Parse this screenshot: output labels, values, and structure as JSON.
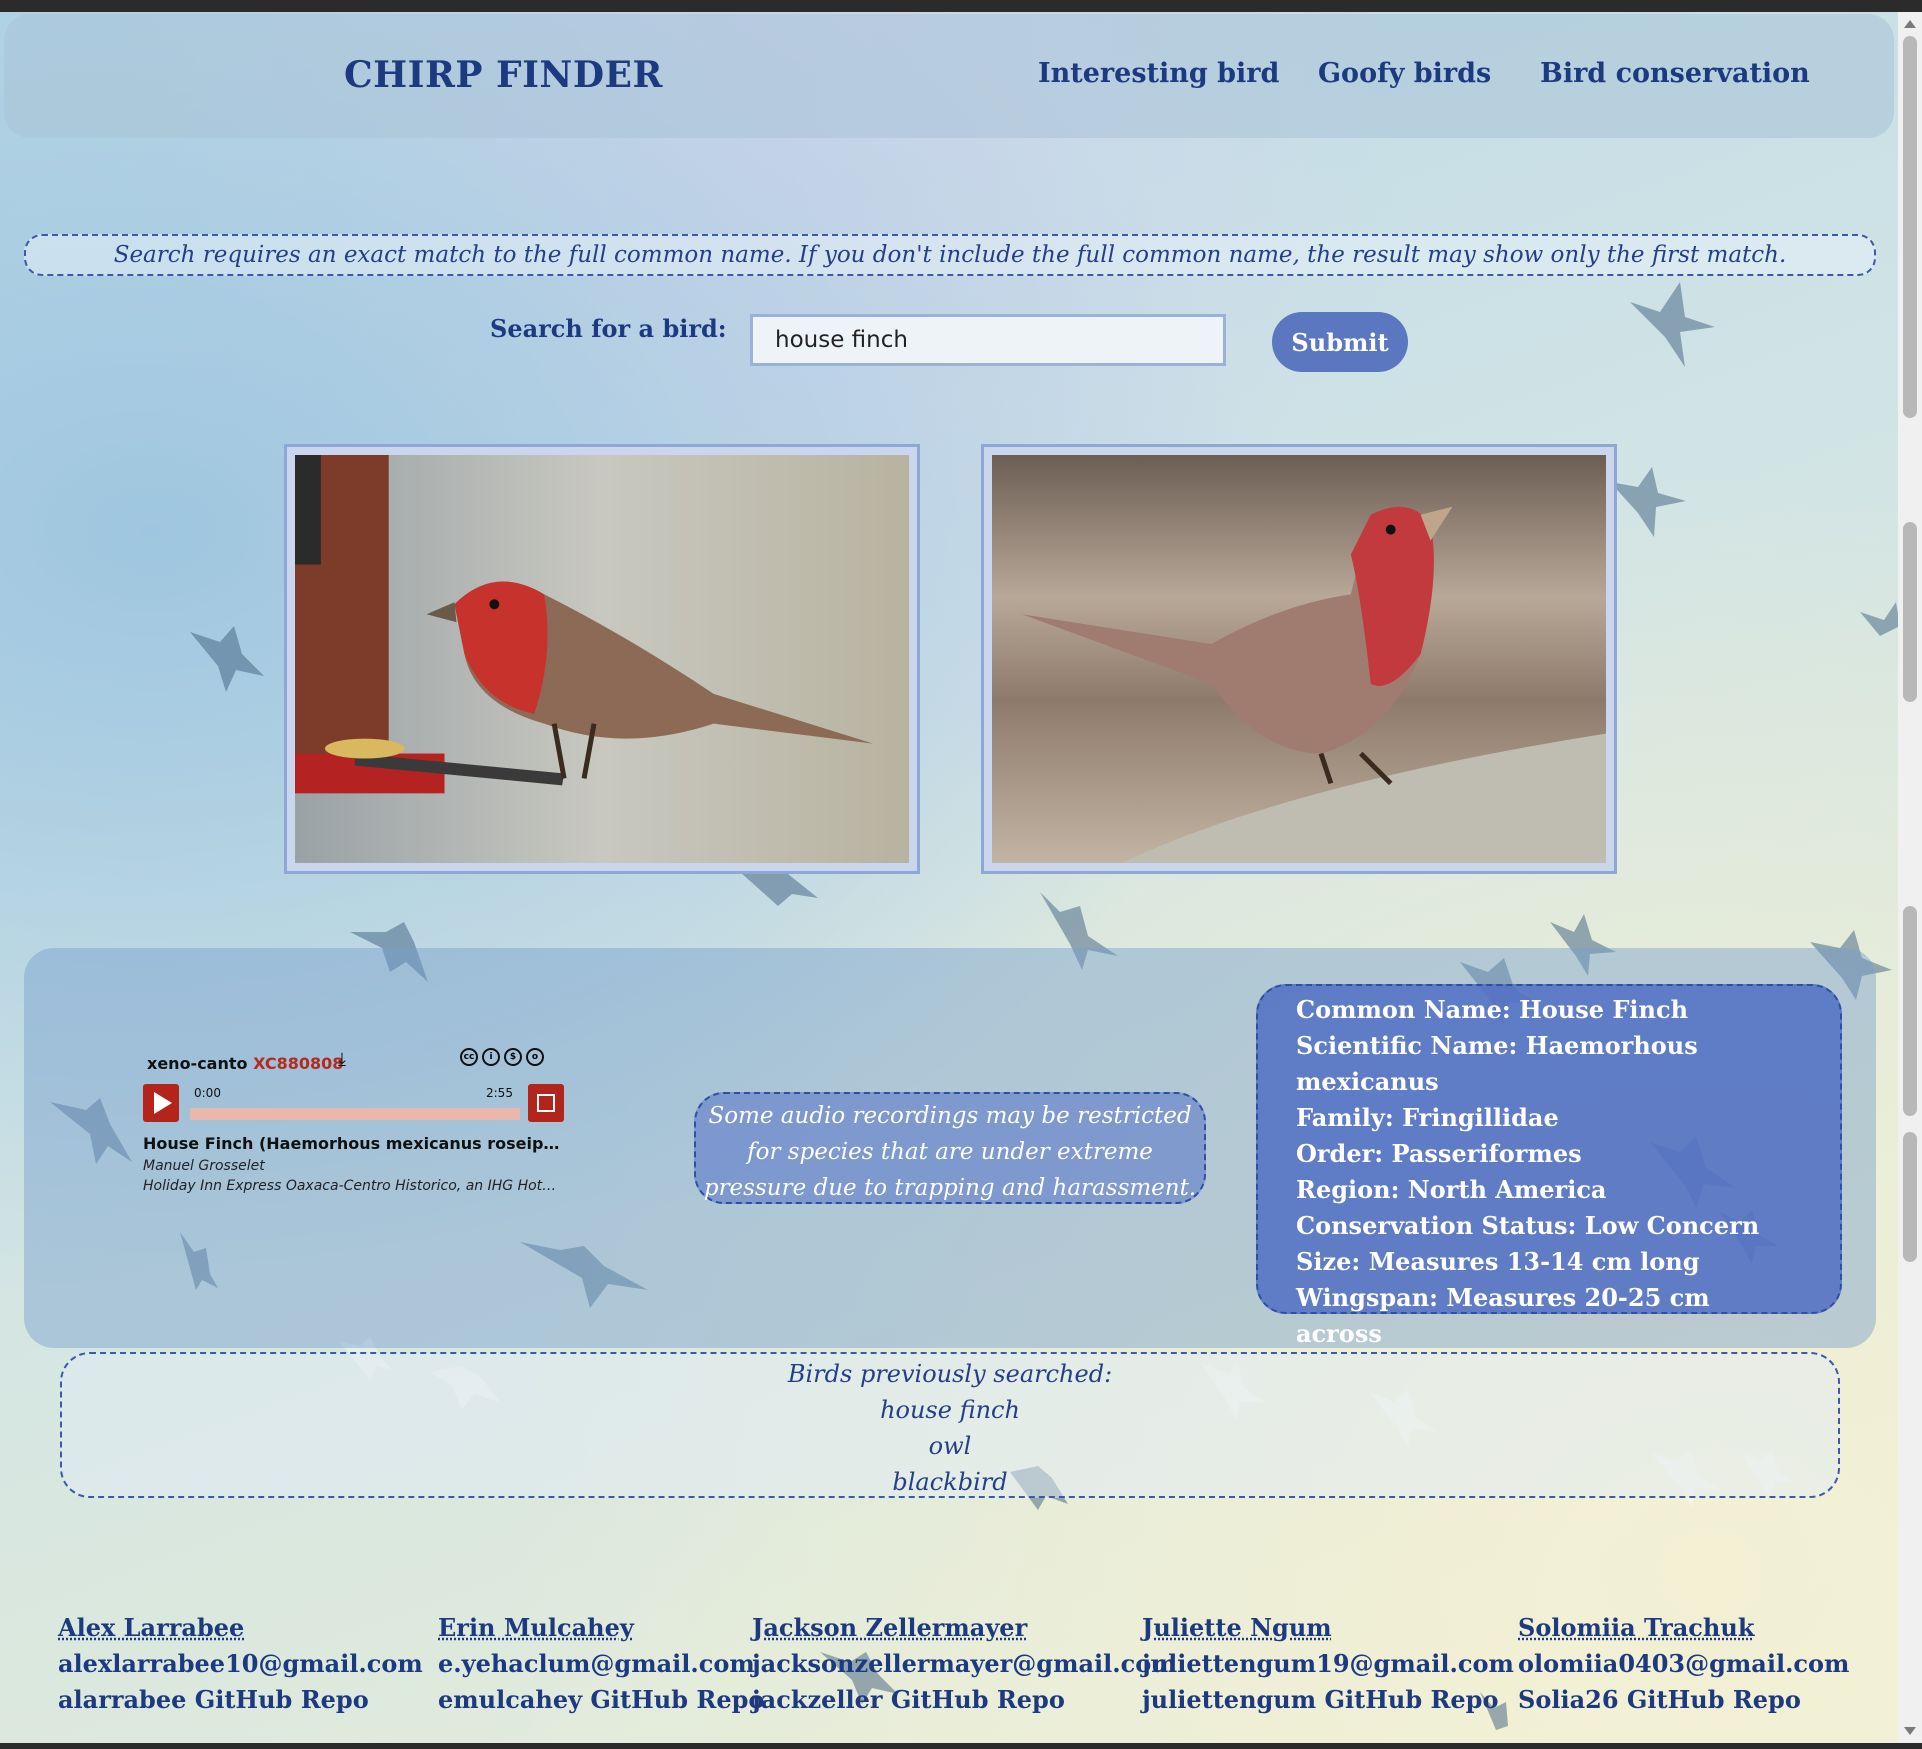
{
  "header": {
    "site_title": "CHIRP FINDER",
    "nav": [
      "Interesting bird",
      "Goofy birds",
      "Bird conservation"
    ]
  },
  "search": {
    "notice": "Search requires an exact match to the full common name. If you don't include the full common name, the result may show only the first match.",
    "label": "Search for a bird:",
    "value": "house finch",
    "submit_label": "Submit"
  },
  "player": {
    "brand": "xeno-canto",
    "recording_id": "XC880808",
    "time_current": "0:00",
    "time_total": "2:55",
    "progress": 0,
    "title": "House Finch (Haemorhous mexicanus roseipectus) ·...",
    "author": "Manuel Grosselet",
    "location": "Holiday Inn Express Oaxaca-Centro Historico, an IHG Hotel (..."
  },
  "audio_note": "Some audio recordings may be restricted for species that are under extreme pressure due to trapping and harassment.",
  "facts": [
    "Common Name: House Finch",
    "Scientific Name: Haemorhous mexicanus",
    "Family: Fringillidae",
    "Order: Passeriformes",
    "Region: North America",
    "Conservation Status: Low Concern",
    "Size: Measures 13-14 cm long",
    "Wingspan: Measures 20-25 cm across"
  ],
  "history": {
    "heading": "Birds previously searched:",
    "items": [
      "house finch",
      "owl",
      "blackbird"
    ]
  },
  "team": [
    {
      "name": "Alex Larrabee",
      "email": "alexlarrabee10@gmail.com",
      "repo": "alarrabee GitHub Repo"
    },
    {
      "name": "Erin Mulcahey",
      "email": "e.yehaclum@gmail.com",
      "repo": "emulcahey GitHub Repo"
    },
    {
      "name": "Jackson Zellermayer",
      "email": "jacksonzellermayer@gmail.com",
      "repo": "jackzeller GitHub Repo"
    },
    {
      "name": "Juliette Ngum",
      "email": "juliettengum19@gmail.com",
      "repo": "juliettengum GitHub Repo"
    },
    {
      "name": "Solomiia Trachuk",
      "email": "olomiia0403@gmail.com",
      "repo": "Solia26 GitHub Repo"
    }
  ],
  "colors": {
    "title": "#1d3a80",
    "submit": "#5b77c0",
    "facts_bg": "#506ec3",
    "player_accent": "#b3251a"
  }
}
